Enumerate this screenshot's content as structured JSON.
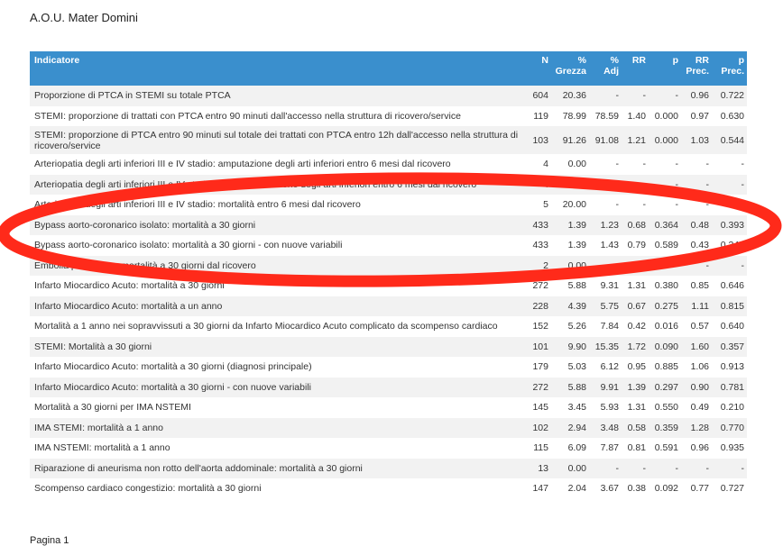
{
  "header": {
    "hospital": "A.O.U. Mater Domini"
  },
  "table": {
    "columns": [
      {
        "line1": "Indicatore",
        "line2": ""
      },
      {
        "line1": "N",
        "line2": ""
      },
      {
        "line1": "%",
        "line2": "Grezza"
      },
      {
        "line1": "%",
        "line2": "Adj"
      },
      {
        "line1": "RR",
        "line2": ""
      },
      {
        "line1": "p",
        "line2": ""
      },
      {
        "line1": "RR",
        "line2": "Prec."
      },
      {
        "line1": "p",
        "line2": "Prec."
      }
    ],
    "rows": [
      [
        "Proporzione di PTCA in STEMI su totale PTCA",
        "604",
        "20.36",
        "-",
        "-",
        "-",
        "0.96",
        "0.722"
      ],
      [
        "STEMI: proporzione di trattati con PTCA entro 90 minuti dall'accesso nella struttura di ricovero/service",
        "119",
        "78.99",
        "78.59",
        "1.40",
        "0.000",
        "0.97",
        "0.630"
      ],
      [
        "STEMI: proporzione di PTCA entro 90 minuti sul totale dei trattati con PTCA entro 12h dall'accesso nella struttura di ricovero/service",
        "103",
        "91.26",
        "91.08",
        "1.21",
        "0.000",
        "1.03",
        "0.544"
      ],
      [
        "Arteriopatia degli arti inferiori III e IV stadio: amputazione degli arti inferiori entro 6 mesi dal ricovero",
        "4",
        "0.00",
        "-",
        "-",
        "-",
        "-",
        "-"
      ],
      [
        "Arteriopatia degli arti inferiori III e IV stadio: rivascolarizzazione degli arti inferiori entro 6 mesi dal ricovero",
        "4",
        "0.00",
        "-",
        "-",
        "-",
        "-",
        "-"
      ],
      [
        "Arteriopatia degli arti inferiori III e IV stadio: mortalità entro 6 mesi dal ricovero",
        "5",
        "20.00",
        "-",
        "-",
        "-",
        "-",
        "-"
      ],
      [
        "Bypass aorto-coronarico isolato: mortalità a 30 giorni",
        "433",
        "1.39",
        "1.23",
        "0.68",
        "0.364",
        "0.48",
        "0.393"
      ],
      [
        "Bypass aorto-coronarico isolato: mortalità a 30 giorni  - con nuove variabili",
        "433",
        "1.39",
        "1.43",
        "0.79",
        "0.589",
        "0.43",
        "0.343"
      ],
      [
        "Embolia polmonare: mortalità a 30 giorni dal ricovero",
        "2",
        "0.00",
        "-",
        "-",
        "-",
        "-",
        "-"
      ],
      [
        "Infarto Miocardico Acuto: mortalità a 30 giorni",
        "272",
        "5.88",
        "9.31",
        "1.31",
        "0.380",
        "0.85",
        "0.646"
      ],
      [
        "Infarto Miocardico Acuto: mortalità a un anno",
        "228",
        "4.39",
        "5.75",
        "0.67",
        "0.275",
        "1.11",
        "0.815"
      ],
      [
        "Mortalità a 1 anno nei sopravvissuti a 30 giorni da Infarto Miocardico Acuto complicato da scompenso cardiaco",
        "152",
        "5.26",
        "7.84",
        "0.42",
        "0.016",
        "0.57",
        "0.640"
      ],
      [
        "STEMI: Mortalità a 30 giorni",
        "101",
        "9.90",
        "15.35",
        "1.72",
        "0.090",
        "1.60",
        "0.357"
      ],
      [
        "Infarto Miocardico Acuto: mortalità a 30 giorni (diagnosi principale)",
        "179",
        "5.03",
        "6.12",
        "0.95",
        "0.885",
        "1.06",
        "0.913"
      ],
      [
        "Infarto Miocardico Acuto: mortalità a 30 giorni - con nuove variabili",
        "272",
        "5.88",
        "9.91",
        "1.39",
        "0.297",
        "0.90",
        "0.781"
      ],
      [
        "Mortalità a 30 giorni per IMA NSTEMI",
        "145",
        "3.45",
        "5.93",
        "1.31",
        "0.550",
        "0.49",
        "0.210"
      ],
      [
        "IMA STEMI: mortalità a 1 anno",
        "102",
        "2.94",
        "3.48",
        "0.58",
        "0.359",
        "1.28",
        "0.770"
      ],
      [
        "IMA NSTEMI: mortalità a 1 anno",
        "115",
        "6.09",
        "7.87",
        "0.81",
        "0.591",
        "0.96",
        "0.935"
      ],
      [
        "Riparazione di aneurisma non rotto dell'aorta addominale: mortalità a 30 giorni",
        "13",
        "0.00",
        "-",
        "-",
        "-",
        "-",
        "-"
      ],
      [
        "Scompenso cardiaco congestizio: mortalità a 30 giorni",
        "147",
        "2.04",
        "3.67",
        "0.38",
        "0.092",
        "0.77",
        "0.727"
      ]
    ]
  },
  "annotation": {
    "stroke_color": "#ff2a1a"
  },
  "footer": {
    "page_label": "Pagina 1"
  }
}
